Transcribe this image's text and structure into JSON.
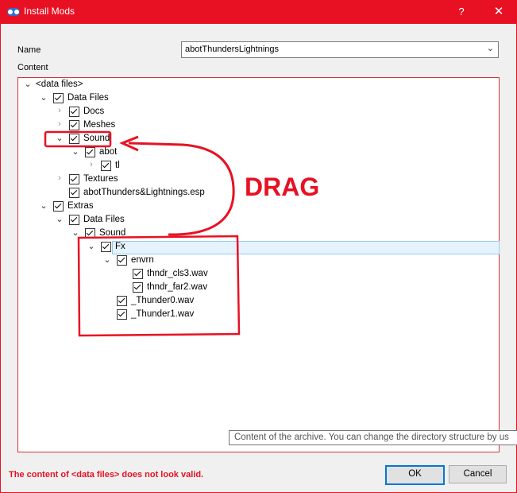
{
  "window": {
    "title": "Install Mods",
    "help": "?",
    "close": "✕"
  },
  "form": {
    "name_label": "Name",
    "name_value": "abotThundersLightnings",
    "content_label": "Content"
  },
  "tree": [
    {
      "label": "<data files>",
      "level": 0,
      "expander": "open",
      "checkbox": false,
      "selected": false
    },
    {
      "label": "Data Files",
      "level": 1,
      "expander": "open",
      "checkbox": true,
      "selected": false
    },
    {
      "label": "Docs",
      "level": 2,
      "expander": "closed",
      "checkbox": true,
      "selected": false
    },
    {
      "label": "Meshes",
      "level": 2,
      "expander": "closed",
      "checkbox": true,
      "selected": false
    },
    {
      "label": "Sound",
      "level": 2,
      "expander": "open",
      "checkbox": true,
      "selected": false
    },
    {
      "label": "abot",
      "level": 3,
      "expander": "open",
      "checkbox": true,
      "selected": false
    },
    {
      "label": "tl",
      "level": 4,
      "expander": "closed",
      "checkbox": true,
      "selected": false
    },
    {
      "label": "Textures",
      "level": 2,
      "expander": "closed",
      "checkbox": true,
      "selected": false
    },
    {
      "label": "abotThunders&Lightnings.esp",
      "level": 2,
      "expander": "none",
      "checkbox": true,
      "selected": false
    },
    {
      "label": "Extras",
      "level": 1,
      "expander": "open",
      "checkbox": true,
      "selected": false
    },
    {
      "label": "Data Files",
      "level": 2,
      "expander": "open",
      "checkbox": true,
      "selected": false
    },
    {
      "label": "Sound",
      "level": 3,
      "expander": "open",
      "checkbox": true,
      "selected": false
    },
    {
      "label": "Fx",
      "level": 4,
      "expander": "open",
      "checkbox": true,
      "selected": true
    },
    {
      "label": "envrn",
      "level": 5,
      "expander": "open",
      "checkbox": true,
      "selected": false
    },
    {
      "label": "thndr_cls3.wav",
      "level": 6,
      "expander": "none",
      "checkbox": true,
      "selected": false
    },
    {
      "label": "thndr_far2.wav",
      "level": 6,
      "expander": "none",
      "checkbox": true,
      "selected": false
    },
    {
      "label": "_Thunder0.wav",
      "level": 5,
      "expander": "none",
      "checkbox": true,
      "selected": false
    },
    {
      "label": "_Thunder1.wav",
      "level": 5,
      "expander": "none",
      "checkbox": true,
      "selected": false
    }
  ],
  "tooltip": "Content of the archive. You can change the directory structure by us",
  "annotation": {
    "text": "DRAG",
    "color": "#e81123"
  },
  "status": {
    "error": "The content of <data files> does not look valid."
  },
  "buttons": {
    "ok": "OK",
    "cancel": "Cancel"
  },
  "colors": {
    "titlebar": "#e81123",
    "error": "#e81123",
    "selection": "#e5f3ff"
  }
}
